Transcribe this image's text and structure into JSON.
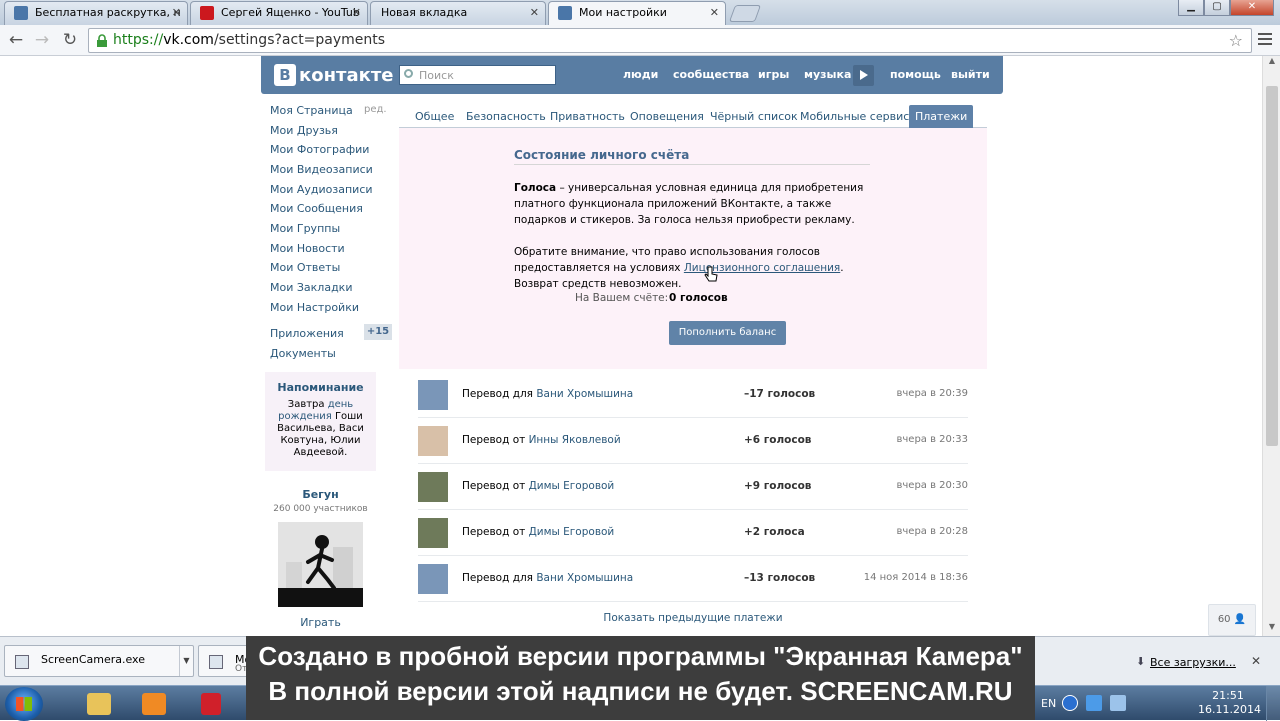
{
  "browser": {
    "tabs": [
      {
        "title": "Бесплатная раскрутка, н",
        "favicon_color": "#4a76a8"
      },
      {
        "title": "Сергей Ященко - YouTub",
        "favicon_color": "#cc181e"
      },
      {
        "title": "Новая вкладка",
        "favicon_color": ""
      },
      {
        "title": "Мои настройки",
        "favicon_color": "#4a76a8"
      }
    ],
    "url_scheme": "https://",
    "url_host": "vk.com",
    "url_path": "/settings?act=payments",
    "window_buttons": {
      "minimize": "▁",
      "maximize": "▢",
      "close": "✕"
    }
  },
  "vk": {
    "logo_mark": "В",
    "logo_text": "контакте",
    "search_placeholder": "Поиск",
    "nav": [
      "люди",
      "сообщества",
      "игры",
      "музыка",
      "помощь",
      "выйти"
    ],
    "sidebar": [
      "Моя Страница",
      "Мои Друзья",
      "Мои Фотографии",
      "Мои Видеозаписи",
      "Мои Аудиозаписи",
      "Мои Сообщения",
      "Мои Группы",
      "Мои Новости",
      "Мои Ответы",
      "Мои Закладки",
      "Мои Настройки",
      "Приложения",
      "Документы"
    ],
    "sidebar_edit": "ред.",
    "apps_badge": "+15",
    "reminder": {
      "title": "Напоминание",
      "text_before": "Завтра ",
      "link": "день рождения",
      "text_after": " Гоши Васильева, Васи Ковтуна, Юлии Авдеевой."
    },
    "ad": {
      "title": "Бегун",
      "subtitle": "260 000 участников",
      "action": "Играть"
    },
    "settings_tabs": [
      "Общее",
      "Безопасность",
      "Приватность",
      "Оповещения",
      "Чёрный список",
      "Мобильные сервисы",
      "Платежи"
    ],
    "payments": {
      "title": "Состояние личного счёта",
      "votes_bold": "Голоса",
      "votes_text": " – универсальная условная единица для приобретения платного функционала приложений ВКонтакте, а также подарков и стикеров. За голоса нельзя приобрести рекламу.",
      "note_before": "Обратите внимание, что право использования голосов предоставляется на условиях ",
      "note_link": "Лицензионного соглашения",
      "note_after": ". Возврат средств невозможен.",
      "balance_label": "На Вашем счёте:",
      "balance_value": "0 голосов",
      "topup_button": "Пополнить баланс"
    },
    "history": [
      {
        "type": "Перевод для",
        "person": "Вани Хромышина",
        "amount": "–17 голосов",
        "time": "вчера в 20:39",
        "avatar": "#7a96b8"
      },
      {
        "type": "Перевод от",
        "person": "Инны Яковлевой",
        "amount": "+6 голосов",
        "time": "вчера в 20:33",
        "avatar": "#d8c0a8"
      },
      {
        "type": "Перевод от",
        "person": "Димы Егоровой",
        "amount": "+9 голосов",
        "time": "вчера в 20:30",
        "avatar": "#6e7a5a"
      },
      {
        "type": "Перевод от",
        "person": "Димы Егоровой",
        "amount": "+2 голоса",
        "time": "вчера в 20:28",
        "avatar": "#6e7a5a"
      },
      {
        "type": "Перевод для",
        "person": "Вани Хромышина",
        "amount": "–13 голосов",
        "time": "14 ноя 2014 в 18:36",
        "avatar": "#7a96b8"
      }
    ],
    "show_previous": "Показать предыдущие платежи",
    "online_count": "60"
  },
  "downloads": {
    "items": [
      {
        "name": "ScreenCamera.exe",
        "status": ""
      },
      {
        "name": "Mova",
        "status": "Отме"
      }
    ],
    "show_all": "Все загрузки..."
  },
  "taskbar": {
    "language": "EN",
    "time": "21:51",
    "date": "16.11.2014"
  },
  "watermark": {
    "line1": "Создано в пробной версии программы \"Экранная Камера\"",
    "line2": "В полной версии этой надписи не будет. SCREENCAM.RU"
  }
}
